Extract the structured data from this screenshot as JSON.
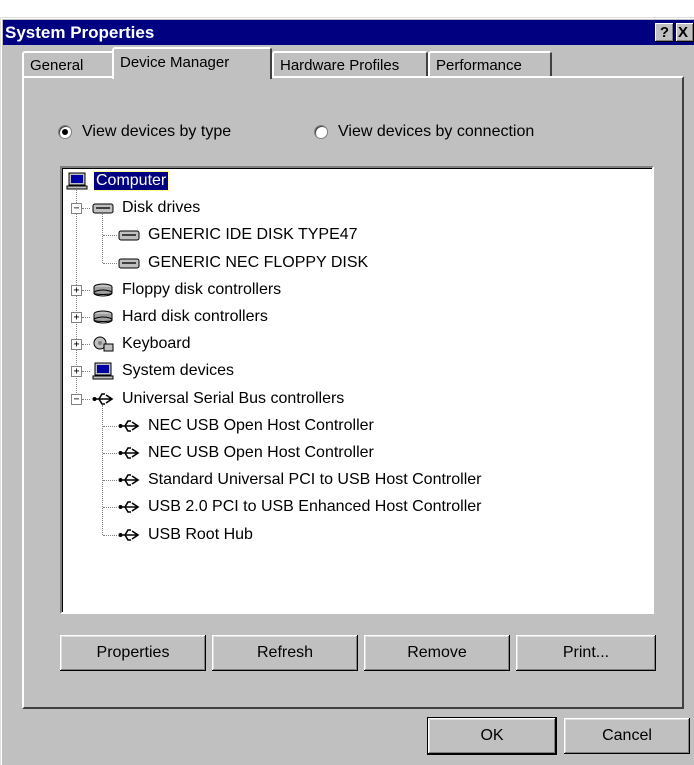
{
  "window": {
    "title": "System Properties",
    "help_label": "?",
    "close_label": "X"
  },
  "tabs": [
    {
      "label": "General"
    },
    {
      "label": "Device Manager"
    },
    {
      "label": "Hardware Profiles"
    },
    {
      "label": "Performance"
    }
  ],
  "view_options": {
    "by_type": "View devices by type",
    "by_connection": "View devices by connection",
    "selected": "by_type"
  },
  "tree": [
    {
      "label": "Computer",
      "icon": "computer-icon",
      "level": 0,
      "selected": true
    },
    {
      "label": "Disk drives",
      "icon": "disk-drive-icon",
      "level": 1,
      "expanded": true
    },
    {
      "label": "GENERIC IDE  DISK TYPE47",
      "icon": "disk-drive-icon",
      "level": 2
    },
    {
      "label": "GENERIC NEC  FLOPPY DISK",
      "icon": "disk-drive-icon",
      "level": 2
    },
    {
      "label": "Floppy disk controllers",
      "icon": "disk-controller-icon",
      "level": 1,
      "expanded": false
    },
    {
      "label": "Hard disk controllers",
      "icon": "disk-controller-icon",
      "level": 1,
      "expanded": false
    },
    {
      "label": "Keyboard",
      "icon": "keyboard-icon",
      "level": 1,
      "expanded": false
    },
    {
      "label": "System devices",
      "icon": "computer-icon",
      "level": 1,
      "expanded": false
    },
    {
      "label": "Universal Serial Bus controllers",
      "icon": "usb-icon",
      "level": 1,
      "expanded": true
    },
    {
      "label": "NEC USB Open Host Controller",
      "icon": "usb-icon",
      "level": 2
    },
    {
      "label": "NEC USB Open Host Controller",
      "icon": "usb-icon",
      "level": 2
    },
    {
      "label": "Standard Universal PCI to USB Host Controller",
      "icon": "usb-icon",
      "level": 2
    },
    {
      "label": "USB 2.0 PCI to USB Enhanced Host Controller",
      "icon": "usb-icon",
      "level": 2
    },
    {
      "label": "USB Root Hub",
      "icon": "usb-icon",
      "level": 2
    }
  ],
  "panel_buttons": {
    "properties": "Properties",
    "refresh": "Refresh",
    "remove": "Remove",
    "print": "Print..."
  },
  "dialog_buttons": {
    "ok": "OK",
    "cancel": "Cancel"
  },
  "colors": {
    "face": "#c0c0c0",
    "titlebar": "#000080",
    "selection": "#000080"
  }
}
